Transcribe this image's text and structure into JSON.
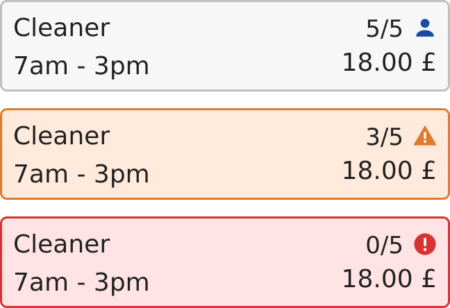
{
  "shifts": [
    {
      "role": "Cleaner",
      "time": "7am - 3pm",
      "count": "5/5",
      "price": "18.00 £",
      "status_icon": "person-icon",
      "icon_color": "#1a4aa8"
    },
    {
      "role": "Cleaner",
      "time": "7am - 3pm",
      "count": "3/5",
      "price": "18.00 £",
      "status_icon": "warning-icon",
      "icon_color": "#e07b2e"
    },
    {
      "role": "Cleaner",
      "time": "7am - 3pm",
      "count": "0/5",
      "price": "18.00 £",
      "status_icon": "error-icon",
      "icon_color": "#d93232"
    }
  ]
}
